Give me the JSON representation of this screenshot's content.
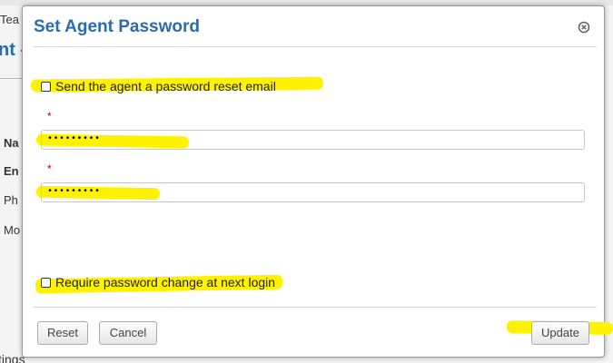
{
  "background": {
    "tab_fragment": "Tea",
    "title_fragment": "nt -",
    "field_labels": [
      "Na",
      "En",
      "Ph",
      "Mo"
    ],
    "bottom_fragment": "tings"
  },
  "modal": {
    "title": "Set Agent Password",
    "close_icon": "close-circle-icon",
    "send_reset_email_label": "Send the agent a password reset email",
    "send_reset_email_checked": false,
    "password": {
      "required_marker": "*",
      "value": "•••••••••"
    },
    "confirm_password": {
      "required_marker": "*",
      "value": "•••••••••"
    },
    "require_change_label": "Require password change at next login",
    "require_change_checked": false,
    "buttons": {
      "reset": "Reset",
      "cancel": "Cancel",
      "update": "Update"
    }
  },
  "colors": {
    "title": "#2a6ab0",
    "highlight": "#fff200",
    "required": "#d00000"
  }
}
